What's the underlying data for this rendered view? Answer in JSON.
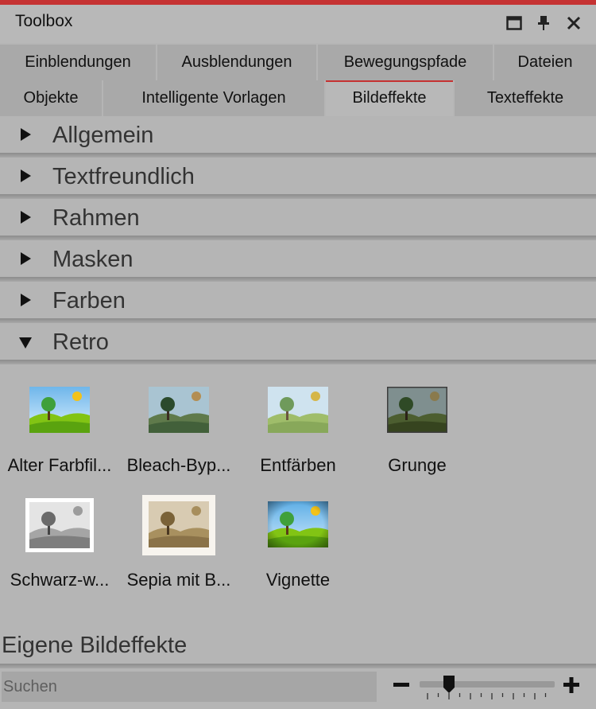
{
  "window": {
    "title": "Toolbox",
    "accent": "#c53232",
    "buttons": [
      "maximize-icon",
      "pin-icon",
      "close-icon"
    ]
  },
  "tabs": {
    "row1": [
      {
        "label": "Einblendungen"
      },
      {
        "label": "Ausblendungen"
      },
      {
        "label": "Bewegungspfade"
      },
      {
        "label": "Dateien"
      }
    ],
    "row2": [
      {
        "label": "Objekte"
      },
      {
        "label": "Intelligente Vorlagen"
      },
      {
        "label": "Bildeffekte"
      },
      {
        "label": "Texteffekte"
      }
    ],
    "active": "Bildeffekte"
  },
  "sections": [
    {
      "label": "Allgemein",
      "expanded": false
    },
    {
      "label": "Textfreundlich",
      "expanded": false
    },
    {
      "label": "Rahmen",
      "expanded": false
    },
    {
      "label": "Masken",
      "expanded": false
    },
    {
      "label": "Farben",
      "expanded": false
    },
    {
      "label": "Retro",
      "expanded": true
    }
  ],
  "effects": [
    {
      "label": "Alter Farbfil...",
      "style": "color"
    },
    {
      "label": "Bleach-Byp...",
      "style": "bleach"
    },
    {
      "label": "Entfärben",
      "style": "faded"
    },
    {
      "label": "Grunge",
      "style": "grunge"
    },
    {
      "label": "Schwarz-w...",
      "style": "bw"
    },
    {
      "label": "Sepia mit B...",
      "style": "sepia"
    },
    {
      "label": "Vignette",
      "style": "vignette"
    }
  ],
  "own_effects": {
    "title": "Eigene Bildeffekte"
  },
  "search": {
    "placeholder": "Suchen",
    "value": ""
  },
  "zoom": {
    "minus": "−",
    "plus": "+",
    "level": 0.22
  }
}
